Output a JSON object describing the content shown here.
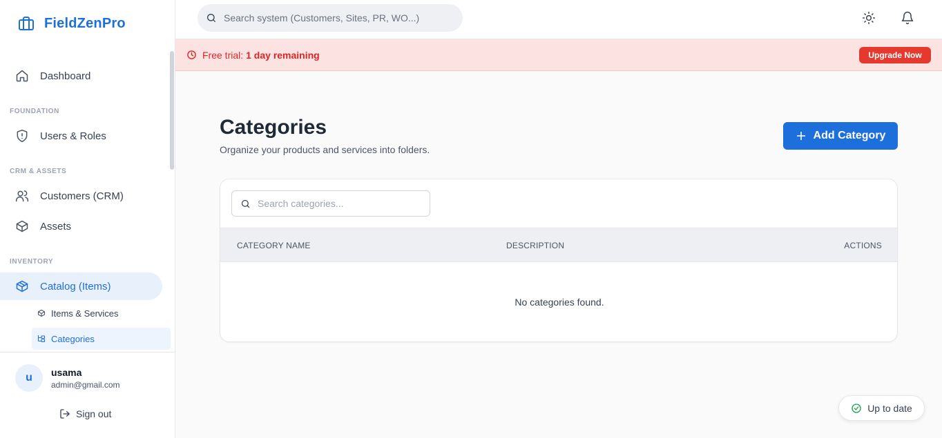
{
  "brand": {
    "name": "FieldZenPro",
    "accent": "#1d6fdc"
  },
  "sidebar": {
    "items": [
      {
        "label": "Dashboard",
        "icon": "home-icon"
      },
      {
        "section": "FOUNDATION"
      },
      {
        "label": "Users & Roles",
        "icon": "shield-icon"
      },
      {
        "section": "CRM & ASSETS"
      },
      {
        "label": "Customers (CRM)",
        "icon": "users-icon"
      },
      {
        "label": "Assets",
        "icon": "box-icon"
      },
      {
        "section": "INVENTORY"
      },
      {
        "label": "Catalog (Items)",
        "icon": "package-icon",
        "active": true
      }
    ],
    "labels": {
      "dashboard": "Dashboard",
      "foundation": "FOUNDATION",
      "users_roles": "Users & Roles",
      "crm_assets": "CRM & ASSETS",
      "customers": "Customers (CRM)",
      "assets": "Assets",
      "inventory": "INVENTORY",
      "catalog": "Catalog (Items)",
      "items_services": "Items & Services",
      "categories": "Categories"
    }
  },
  "user": {
    "initial": "u",
    "name": "usama",
    "email": "admin@gmail.com",
    "signout_label": "Sign out"
  },
  "topbar": {
    "search_placeholder": "Search system (Customers, Sites, PR, WO...)"
  },
  "banner": {
    "prefix": "Free trial:",
    "highlight": "1 day remaining",
    "upgrade_label": "Upgrade Now",
    "color": "#dc2626"
  },
  "page": {
    "title": "Categories",
    "subtitle": "Organize your products and services into folders.",
    "add_label": "Add Category",
    "search_placeholder": "Search categories...",
    "columns": [
      "CATEGORY NAME",
      "DESCRIPTION",
      "ACTIONS"
    ],
    "empty_text": "No categories found."
  },
  "status": {
    "label": "Up to date",
    "color": "#16a34a"
  }
}
